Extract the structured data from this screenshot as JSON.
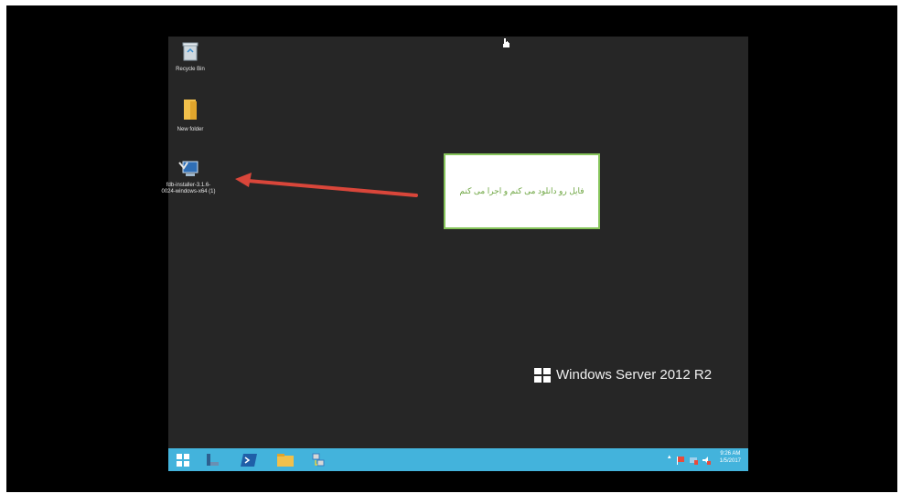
{
  "desktop": {
    "icons": [
      {
        "label": "Recycle Bin",
        "icon": "recycle-bin-icon"
      },
      {
        "label": "New folder",
        "icon": "folder-icon"
      },
      {
        "label": "fdb-installer-3.1.6-0024-windows-x64 (1)",
        "icon": "installer-icon"
      }
    ],
    "os_brand": "Windows Server 2012 R2"
  },
  "callout": {
    "text": "فایل رو دانلود می کنم و اجرا می کنم",
    "border_color": "#86c45a",
    "text_color": "#6ea642"
  },
  "arrow": {
    "color": "#d9463a"
  },
  "taskbar": {
    "color": "#43b3dc",
    "buttons": [
      "windows-start-icon",
      "server-manager-icon",
      "powershell-icon",
      "file-explorer-icon",
      "network-icon"
    ],
    "tray": {
      "icons": [
        "show-hidden-icons-chevron",
        "flag-icon",
        "network-status-icon",
        "volume-icon"
      ],
      "time": "9:26 AM",
      "date": "1/5/2017"
    }
  }
}
